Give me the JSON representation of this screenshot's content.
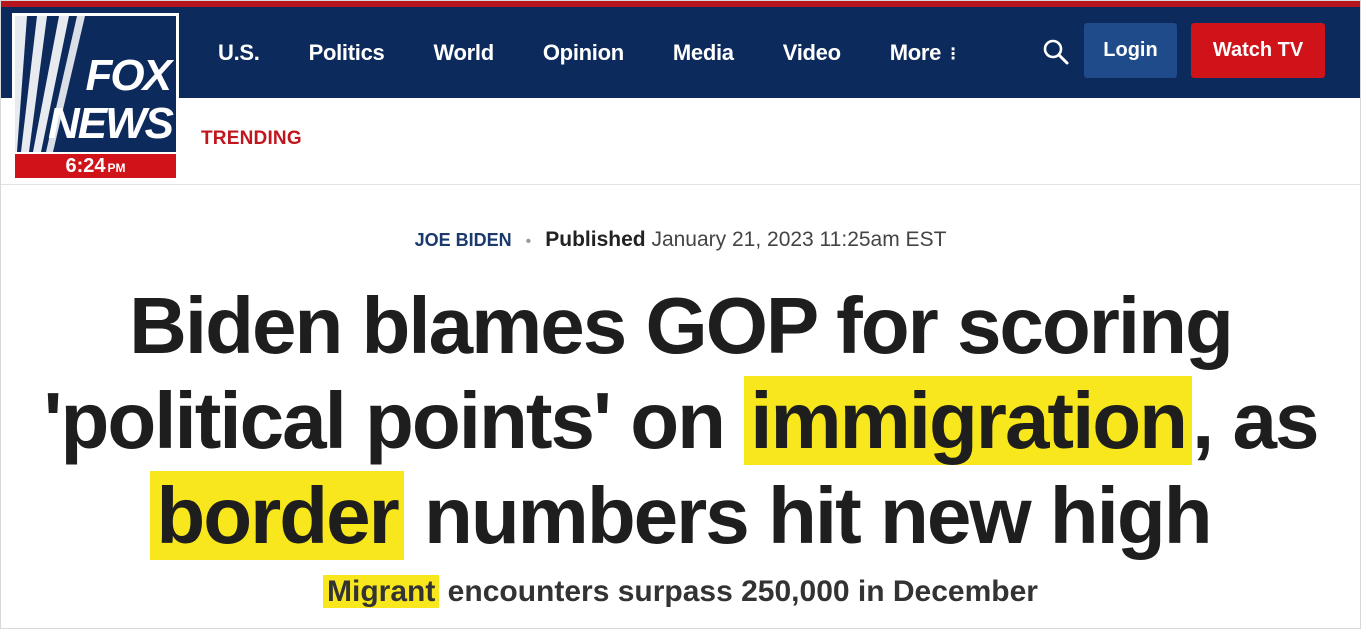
{
  "logo": {
    "line1": "FOX",
    "line2": "NEWS",
    "time": "6:24",
    "ampm": "PM"
  },
  "nav": {
    "items": [
      {
        "label": "U.S."
      },
      {
        "label": "Politics"
      },
      {
        "label": "World"
      },
      {
        "label": "Opinion"
      },
      {
        "label": "Media"
      },
      {
        "label": "Video"
      }
    ],
    "more_label": "More",
    "more_icon": "⋮",
    "search_icon": "search-icon",
    "login_label": "Login",
    "watch_label": "Watch TV"
  },
  "trending": {
    "label": "TRENDING"
  },
  "article": {
    "category": "JOE BIDEN",
    "separator": "•",
    "published_label": "Published",
    "published_date": "January 21, 2023 11:25am EST",
    "headline": {
      "part1": "Biden blames GOP for scoring 'political points' on ",
      "highlight1": "immigration",
      "part2": ", as ",
      "highlight2": "border",
      "part3": " numbers hit new high"
    },
    "subhead": {
      "highlight": "Migrant",
      "rest": " encounters surpass 250,000 in December"
    }
  },
  "colors": {
    "nav_bg": "#0d2a5c",
    "top_strip": "#b5161d",
    "brand_red": "#d01219",
    "login_bg": "#1f4b8a",
    "highlight": "#f8e71c",
    "trending": "#c0161d"
  }
}
